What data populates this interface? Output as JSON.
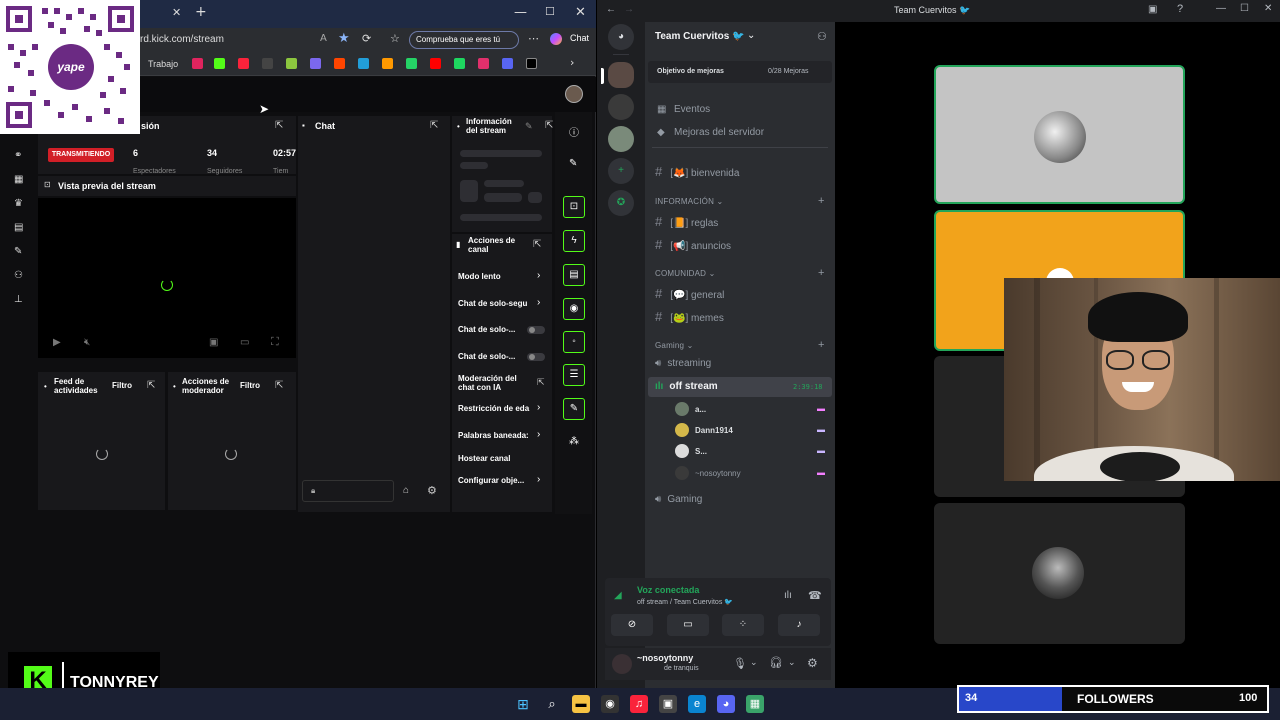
{
  "browser": {
    "url": "rd.kick.com/stream",
    "verify_pill": "Comprueba que eres tú",
    "chat_label": "Chat",
    "bookmarks_label": "Trabajo",
    "window_controls": [
      "—",
      "☐",
      "✕"
    ],
    "new_tab": "+",
    "tab_close": "✕"
  },
  "qr": {
    "brand": "yape"
  },
  "kick": {
    "session_title": "sión",
    "live_badge": "TRANSMITIENDO",
    "stats": [
      {
        "value": "6",
        "label": "Espectadores"
      },
      {
        "value": "34",
        "label": "Seguidores"
      },
      {
        "value": "02:57",
        "label": "Tiem"
      }
    ],
    "preview_title": "Vista previa del stream",
    "chat_title": "Chat",
    "info_title": "Información del stream",
    "actions_title": "Acciones de canal",
    "actions": [
      {
        "label": "Modo lento",
        "kind": "chevron"
      },
      {
        "label": "Chat de solo-segu",
        "kind": "chevron"
      },
      {
        "label": "Chat de solo-...",
        "kind": "toggle"
      },
      {
        "label": "Chat de solo-...",
        "kind": "toggle"
      },
      {
        "label": "Moderación del chat con IA",
        "kind": "popout"
      },
      {
        "label": "Restricción de eda",
        "kind": "chevron"
      },
      {
        "label": "Palabras baneada:",
        "kind": "chevron"
      },
      {
        "label": "Hostear canal",
        "kind": "none"
      },
      {
        "label": "Configurar obje...",
        "kind": "chevron"
      }
    ],
    "activity_title": "Feed de actividades",
    "activity_filter": "Filtro",
    "mod_title": "Acciones de moderador",
    "mod_filter": "Filtro",
    "streamer_name": "TONNYREY"
  },
  "discord": {
    "window_title": "Team Cuervitos 🐦",
    "server_name": "Team Cuervitos 🐦",
    "boost_goal": "Objetivo de mejoras",
    "boost_count": "0/28 Mejoras",
    "events": "Eventos",
    "server_boosts": "Mejoras del servidor",
    "channels": {
      "welcome": "bienvenida",
      "info_cat": "INFORMACIÓN",
      "rules": "reglas",
      "announcements": "anuncios",
      "community_cat": "COMUNIDAD",
      "general": "general",
      "memes": "memes",
      "gaming_cat": "Gaming",
      "streaming": "streaming",
      "off_stream": "off stream",
      "off_stream_time": "2:39:18",
      "gaming_voice": "Gaming"
    },
    "members": [
      "a...",
      "Dann1914",
      "S...",
      "~nosoytonny"
    ],
    "voice_connected": "Voz conectada",
    "voice_location": "off stream / Team Cuervitos 🐦",
    "user_name": "~nosoytonny",
    "user_status": "de tranquis"
  },
  "overlay": {
    "followers_count": "34",
    "followers_label": "FOLLOWERS",
    "followers_goal": "100"
  },
  "colors": {
    "kick_green": "#53fc18",
    "live_red": "#d21f27",
    "discord_green": "#23a55a",
    "tile_orange": "#f2a31b",
    "followers_blue": "#2847c9"
  }
}
